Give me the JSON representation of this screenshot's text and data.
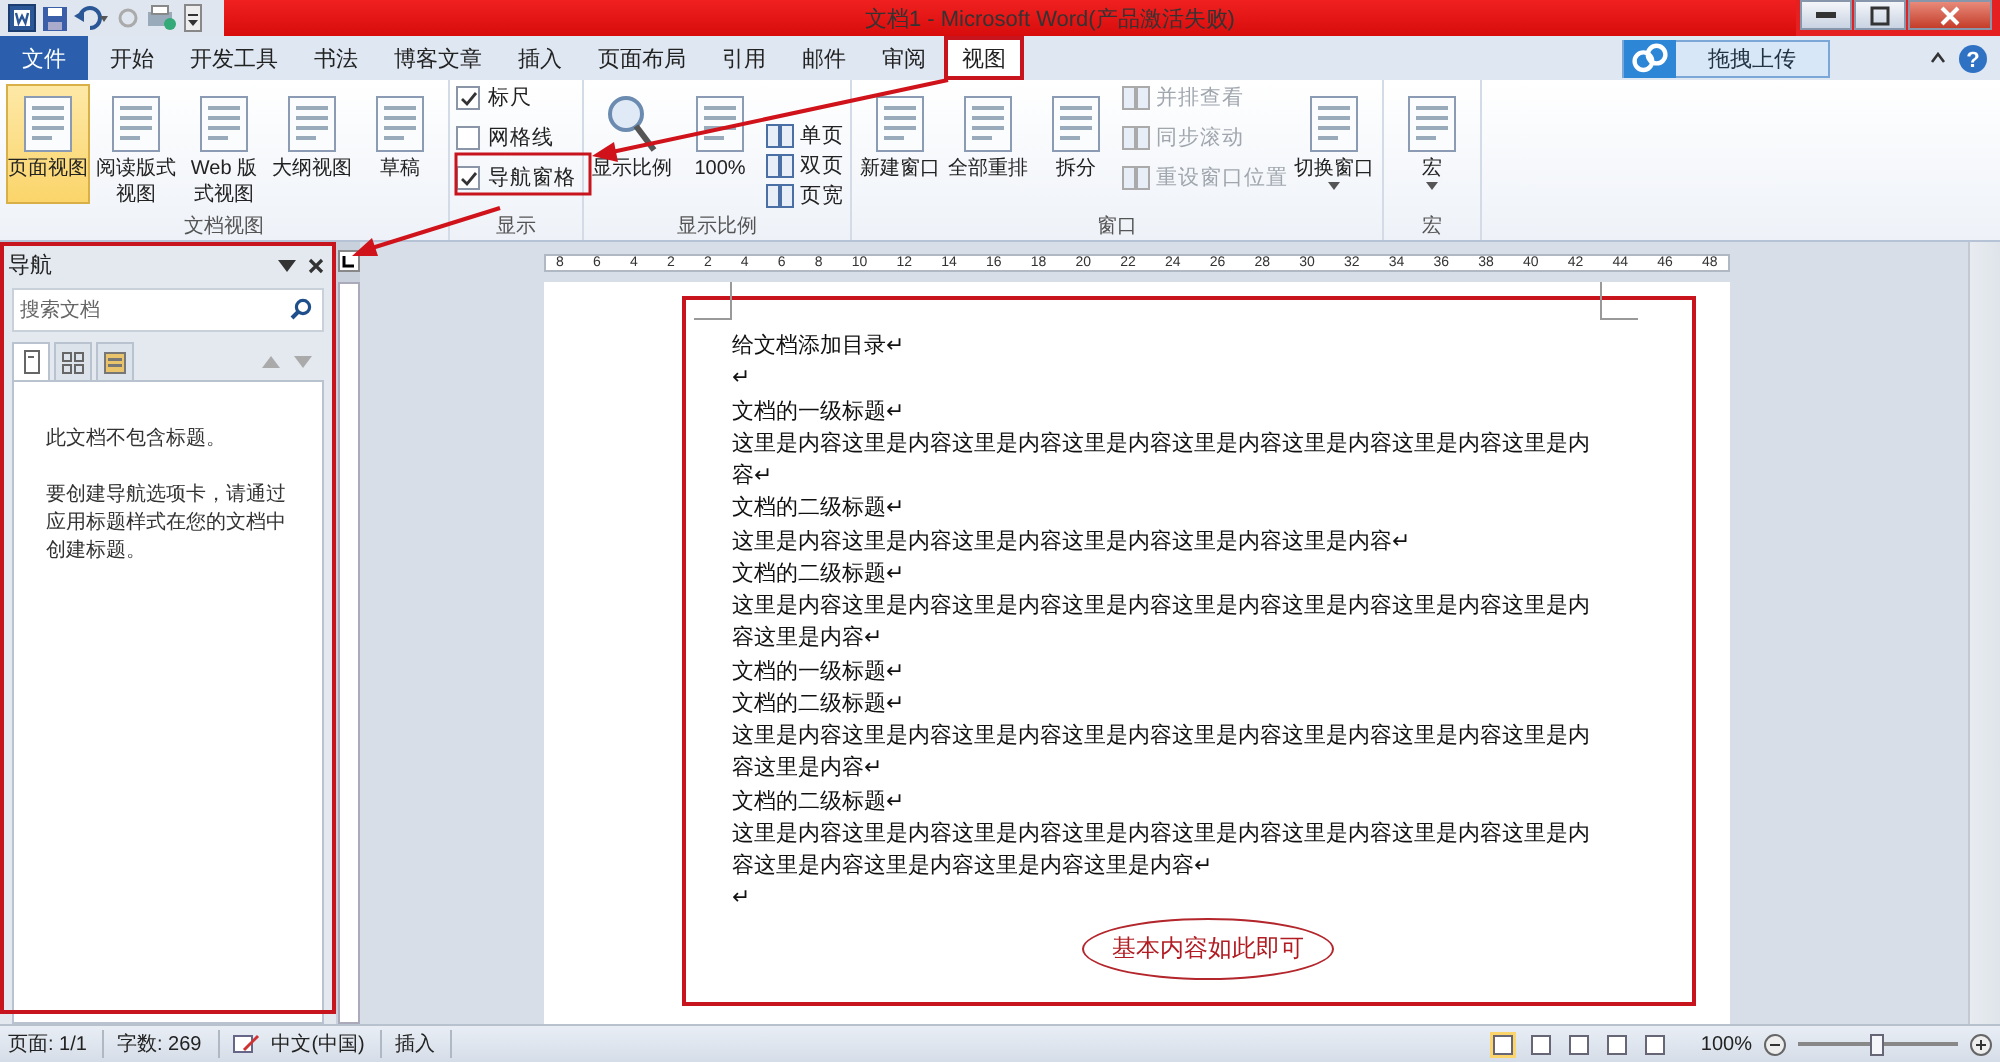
{
  "title_bar": {
    "title": "文档1 - Microsoft Word(产品激活失败)"
  },
  "tabs": [
    {
      "label": "文件",
      "kind": "file",
      "selected": false
    },
    {
      "label": "开始",
      "kind": "tab",
      "selected": false
    },
    {
      "label": "开发工具",
      "kind": "tab",
      "selected": false
    },
    {
      "label": "书法",
      "kind": "tab",
      "selected": false
    },
    {
      "label": "博客文章",
      "kind": "tab",
      "selected": false
    },
    {
      "label": "插入",
      "kind": "tab",
      "selected": false
    },
    {
      "label": "页面布局",
      "kind": "tab",
      "selected": false
    },
    {
      "label": "引用",
      "kind": "tab",
      "selected": false
    },
    {
      "label": "邮件",
      "kind": "tab",
      "selected": false
    },
    {
      "label": "审阅",
      "kind": "tab",
      "selected": false
    },
    {
      "label": "视图",
      "kind": "tab",
      "selected": true
    }
  ],
  "upload_button": "拖拽上传",
  "help_button": "?",
  "ribbon": {
    "groups": [
      {
        "label": "文档视图",
        "items": [
          {
            "kind": "large",
            "label": "页面视图",
            "selected": true
          },
          {
            "kind": "large",
            "label": "阅读版式视图",
            "selected": false
          },
          {
            "kind": "large",
            "label": "Web 版式视图",
            "selected": false
          },
          {
            "kind": "large",
            "label": "大纲视图",
            "selected": false
          },
          {
            "kind": "large",
            "label": "草稿",
            "selected": false
          }
        ]
      },
      {
        "label": "显示",
        "items": [
          {
            "kind": "check",
            "label": "标尺",
            "checked": true
          },
          {
            "kind": "check",
            "label": "网格线",
            "checked": false
          },
          {
            "kind": "check",
            "label": "导航窗格",
            "checked": true
          }
        ]
      },
      {
        "label": "显示比例",
        "items": [
          {
            "kind": "large",
            "label": "显示比例"
          },
          {
            "kind": "large",
            "label": "100%"
          },
          {
            "kind": "small",
            "label": "单页",
            "disabled": false
          },
          {
            "kind": "small",
            "label": "双页",
            "disabled": false
          },
          {
            "kind": "small",
            "label": "页宽",
            "disabled": false
          }
        ]
      },
      {
        "label": "窗口",
        "items": [
          {
            "kind": "large",
            "label": "新建窗口"
          },
          {
            "kind": "large",
            "label": "全部重排"
          },
          {
            "kind": "large",
            "label": "拆分"
          },
          {
            "kind": "small",
            "label": "并排查看",
            "disabled": true
          },
          {
            "kind": "small",
            "label": "同步滚动",
            "disabled": true
          },
          {
            "kind": "small",
            "label": "重设窗口位置",
            "disabled": true
          },
          {
            "kind": "dropdown",
            "label": "切换窗口"
          }
        ]
      },
      {
        "label": "宏",
        "items": [
          {
            "kind": "dropdown",
            "label": "宏"
          }
        ]
      }
    ]
  },
  "navigation": {
    "title": "导航",
    "search": {
      "placeholder": "搜索文档"
    },
    "tabs": [
      {
        "selected": true
      },
      {
        "selected": false
      },
      {
        "selected": false
      }
    ],
    "messages": [
      "此文档不包含标题。",
      "要创建导航选项卡，请通过应用标题样式在您的文档中创建标题。"
    ]
  },
  "ruler": [
    "8",
    "6",
    "4",
    "2",
    "2",
    "4",
    "6",
    "8",
    "10",
    "12",
    "14",
    "16",
    "18",
    "20",
    "22",
    "24",
    "26",
    "28",
    "30",
    "32",
    "34",
    "36",
    "38",
    "40",
    "42",
    "44",
    "46",
    "48"
  ],
  "document": {
    "paragraphs": [
      "给文档添加目录↵",
      "↵",
      "文档的一级标题↵",
      "这里是内容这里是内容这里是内容这里是内容这里是内容这里是内容这里是内容这里是内容↵",
      "文档的二级标题↵",
      "这里是内容这里是内容这里是内容这里是内容这里是内容这里是内容↵",
      "文档的二级标题↵",
      "这里是内容这里是内容这里是内容这里是内容这里是内容这里是内容这里是内容这里是内容这里是内容↵",
      "文档的一级标题↵",
      "文档的二级标题↵",
      "这里是内容这里是内容这里是内容这里是内容这里是内容这里是内容这里是内容这里是内容这里是内容↵",
      "文档的二级标题↵",
      "这里是内容这里是内容这里是内容这里是内容这里是内容这里是内容这里是内容这里是内容这里是内容这里是内容这里是内容这里是内容↵",
      "↵"
    ],
    "callout": "基本内容如此即可"
  },
  "status_bar": {
    "items": [
      "页面: 1/1",
      "字数: 269",
      "中文(中国)",
      "插入"
    ],
    "zoom": {
      "label": "100%",
      "level": 0.5
    }
  }
}
